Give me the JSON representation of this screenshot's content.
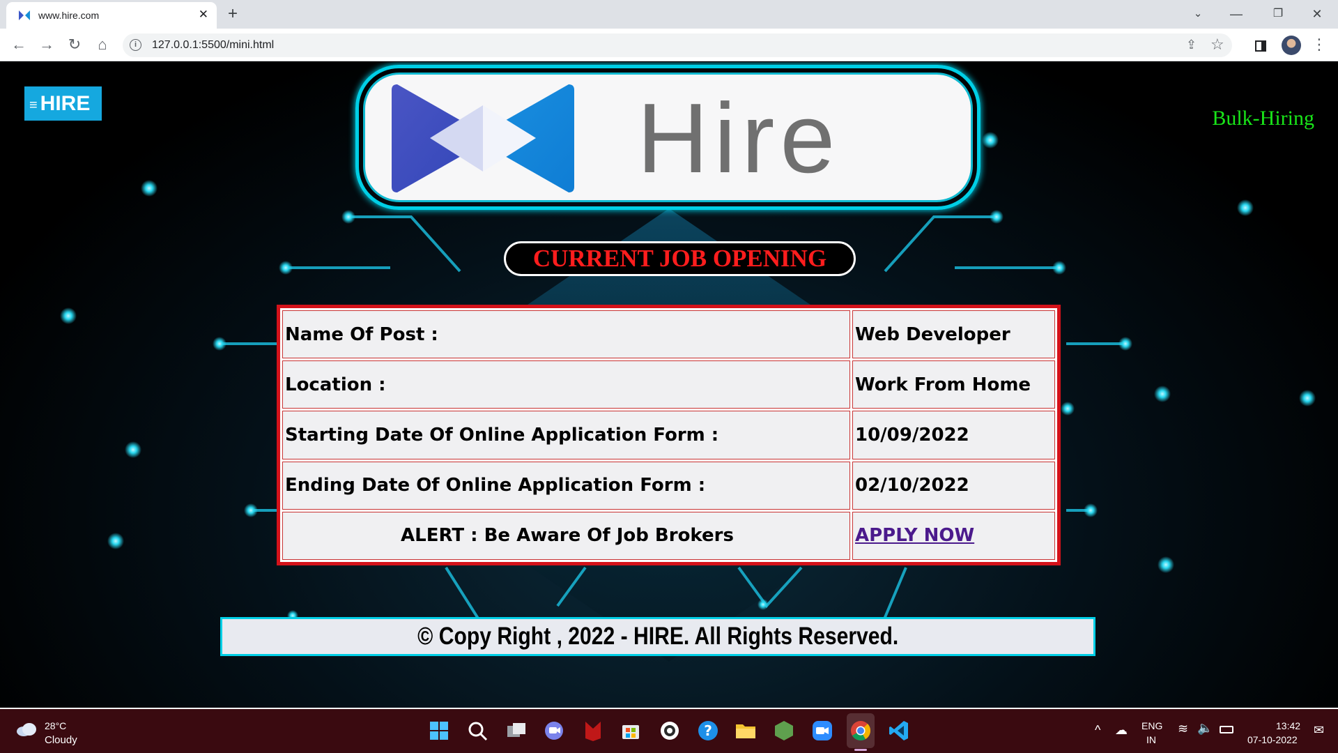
{
  "browser": {
    "tab_title": "www.hire.com",
    "tab_close": "✕",
    "new_tab": "+",
    "url": "127.0.0.1:5500/mini.html",
    "window_controls": {
      "tab_search": "⌄",
      "minimize": "—",
      "maximize": "❐",
      "close": "✕"
    },
    "nav": {
      "back": "←",
      "forward": "→",
      "reload": "↻",
      "home": "⌂",
      "menu": "⋮"
    }
  },
  "page": {
    "menu_button": {
      "icon": "≡",
      "label": "HIRE"
    },
    "bulk_hiring": "Bulk-Hiring",
    "logo_wordmark": "Hire",
    "section_title": "CURRENT JOB OPENING",
    "job_rows": [
      {
        "label": "Name Of Post :",
        "value": "Web Developer"
      },
      {
        "label": "Location :",
        "value": "Work From Home"
      },
      {
        "label": "Starting Date Of Online Application Form :",
        "value": "10/09/2022"
      },
      {
        "label": "Ending Date Of Online Application Form :",
        "value": "02/10/2022"
      }
    ],
    "alert": "ALERT : Be Aware Of Job Brokers",
    "apply_now": "APPLY NOW",
    "footer": "©  Copy Right ,  2022 -  HIRE.   All Rights Reserved.",
    "colors": {
      "accent_cyan": "#00cfe6",
      "title_red": "#ff1d1d",
      "bulk_green": "#19e619",
      "menu_blue": "#15a8df"
    }
  },
  "taskbar": {
    "weather_temp": "28°C",
    "weather_condition": "Cloudy",
    "apps": [
      "windows-start-icon",
      "search-icon",
      "task-view-icon",
      "teams-chat-icon",
      "mcafee-icon",
      "store-icon",
      "app-circle-icon",
      "help-icon",
      "file-explorer-icon",
      "nodejs-icon",
      "zoom-icon",
      "chrome-icon",
      "vscode-icon"
    ],
    "lang_line1": "ENG",
    "lang_line2": "IN",
    "time": "13:42",
    "date": "07-10-2022"
  }
}
